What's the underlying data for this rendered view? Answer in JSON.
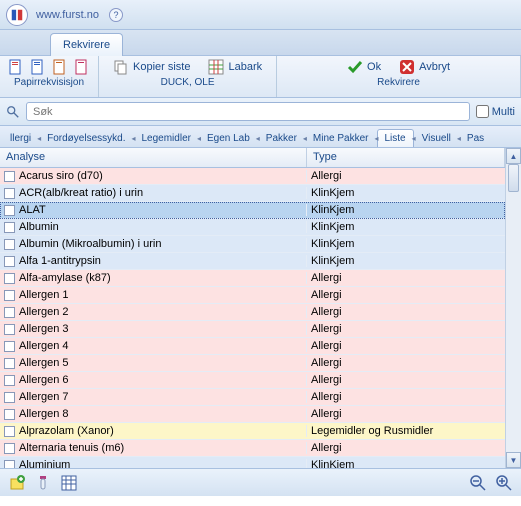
{
  "header": {
    "url": "www.furst.no"
  },
  "mainTab": "Rekvirere",
  "toolbar": {
    "group1_label": "Papirrekvisisjon",
    "kopier": "Kopier siste",
    "labark": "Labark",
    "patient": "DUCK, OLE",
    "ok": "Ok",
    "avbryt": "Avbryt",
    "action_label": "Rekvirere"
  },
  "search": {
    "placeholder": "Søk",
    "multi": "Multi"
  },
  "filterTabs": [
    "llergi",
    "Fordøyelsessykd.",
    "Legemidler",
    "Egen Lab",
    "Pakker",
    "Mine Pakker",
    "Liste",
    "Visuell",
    "Pas"
  ],
  "activeFilterTab": 6,
  "columns": {
    "c1": "Analyse",
    "c2": "Type"
  },
  "rows": [
    {
      "name": "Acarus siro (d70)",
      "type": "Allergi",
      "cls": "pink"
    },
    {
      "name": "ACR(alb/kreat ratio) i urin",
      "type": "KlinKjem",
      "cls": "blue"
    },
    {
      "name": "ALAT",
      "type": "KlinKjem",
      "cls": "blue",
      "selected": true
    },
    {
      "name": "Albumin",
      "type": "KlinKjem",
      "cls": "blue"
    },
    {
      "name": "Albumin (Mikroalbumin) i urin",
      "type": "KlinKjem",
      "cls": "blue"
    },
    {
      "name": "Alfa 1-antitrypsin",
      "type": "KlinKjem",
      "cls": "blue"
    },
    {
      "name": "Alfa-amylase (k87)",
      "type": "Allergi",
      "cls": "pink"
    },
    {
      "name": "Allergen 1",
      "type": "Allergi",
      "cls": "pink"
    },
    {
      "name": "Allergen 2",
      "type": "Allergi",
      "cls": "pink"
    },
    {
      "name": "Allergen 3",
      "type": "Allergi",
      "cls": "pink"
    },
    {
      "name": "Allergen 4",
      "type": "Allergi",
      "cls": "pink"
    },
    {
      "name": "Allergen 5",
      "type": "Allergi",
      "cls": "pink"
    },
    {
      "name": "Allergen 6",
      "type": "Allergi",
      "cls": "pink"
    },
    {
      "name": "Allergen 7",
      "type": "Allergi",
      "cls": "pink"
    },
    {
      "name": "Allergen 8",
      "type": "Allergi",
      "cls": "pink"
    },
    {
      "name": "Alprazolam (Xanor)",
      "type": "Legemidler og Rusmidler",
      "cls": "yellow"
    },
    {
      "name": "Alternaria tenuis (m6)",
      "type": "Allergi",
      "cls": "pink"
    },
    {
      "name": "Aluminium",
      "type": "KlinKjem",
      "cls": "blue"
    }
  ]
}
